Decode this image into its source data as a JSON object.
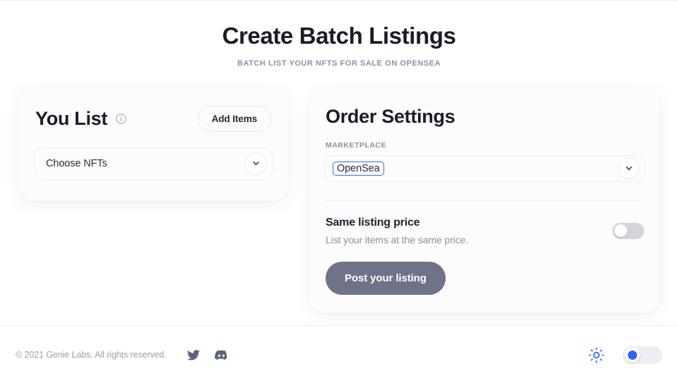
{
  "header": {
    "title": "Create Batch Listings",
    "subtitle": "BATCH LIST YOUR NFTS FOR SALE ON OPENSEA"
  },
  "you_list": {
    "title": "You List",
    "info_icon": "info-circle-icon",
    "add_items_label": "Add Items",
    "nft_select": {
      "value": "Choose NFTs",
      "chevron_icon": "chevron-down-icon"
    }
  },
  "order_settings": {
    "title": "Order Settings",
    "marketplace": {
      "label": "MARKETPLACE",
      "value": "OpenSea",
      "focused": true,
      "focus_color": "#3c67f5",
      "chevron_icon": "chevron-down-icon"
    },
    "same_price": {
      "title": "Same listing price",
      "description": "List your items at the same price.",
      "toggle_state": "off"
    },
    "post_label": "Post your listing",
    "post_color": "#6e7388"
  },
  "footer": {
    "copyright": "© 2021 Genie Labs. All rights reserved.",
    "social": [
      {
        "name": "twitter-icon"
      },
      {
        "name": "discord-icon"
      }
    ],
    "theme": {
      "sun_icon": "sun-icon",
      "accent_color": "#2f62f4",
      "toggle_state": "light"
    }
  }
}
